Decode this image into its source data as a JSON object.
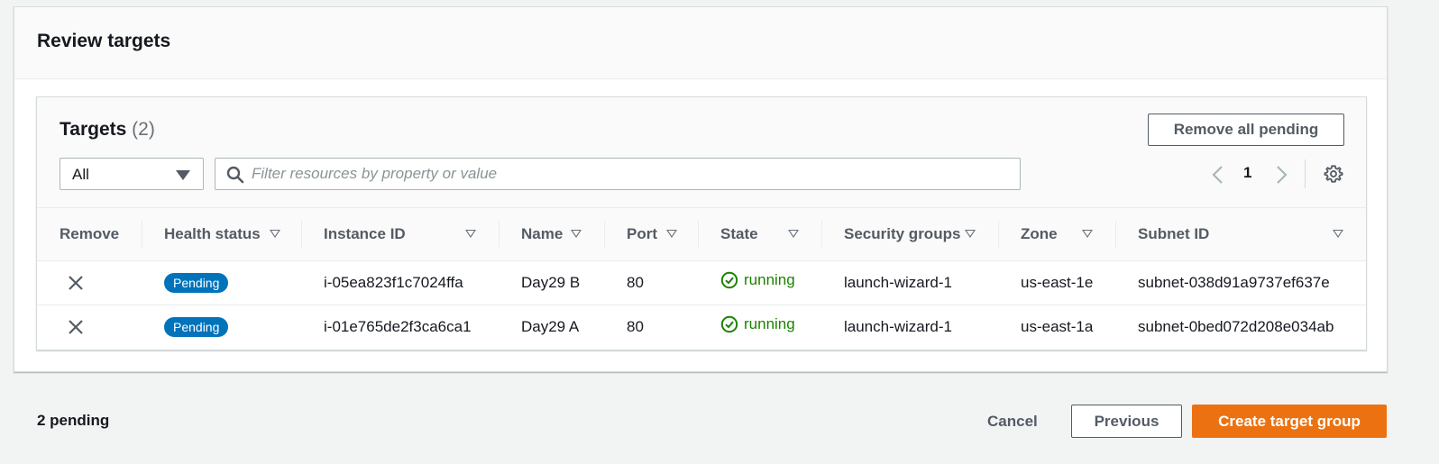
{
  "panel": {
    "title": "Review targets"
  },
  "targets": {
    "title": "Targets",
    "count": "(2)",
    "remove_all_label": "Remove all pending",
    "filter_select_value": "All",
    "search_placeholder": "Filter resources by property or value",
    "page_number": "1"
  },
  "table": {
    "columns": [
      "Remove",
      "Health status",
      "Instance ID",
      "Name",
      "Port",
      "State",
      "Security groups",
      "Zone",
      "Subnet ID"
    ],
    "rows": [
      {
        "health": "Pending",
        "instance_id": "i-05ea823f1c7024ffa",
        "name": "Day29 B",
        "port": "80",
        "state": "running",
        "security_group": "launch-wizard-1",
        "zone": "us-east-1e",
        "subnet_id": "subnet-038d91a9737ef637e"
      },
      {
        "health": "Pending",
        "instance_id": "i-01e765de2f3ca6ca1",
        "name": "Day29 A",
        "port": "80",
        "state": "running",
        "security_group": "launch-wizard-1",
        "zone": "us-east-1a",
        "subnet_id": "subnet-0bed072d208e034ab"
      }
    ]
  },
  "footer": {
    "pending_text": "2 pending",
    "cancel_label": "Cancel",
    "previous_label": "Previous",
    "create_label": "Create target group"
  },
  "colors": {
    "accent": "#ec7211",
    "badge": "#0073bb",
    "running": "#1d8102"
  },
  "icons": [
    "search-icon",
    "caret-down-icon",
    "chevron-left-icon",
    "chevron-right-icon",
    "gear-icon",
    "close-icon",
    "check-circle-icon",
    "sort-icon"
  ]
}
